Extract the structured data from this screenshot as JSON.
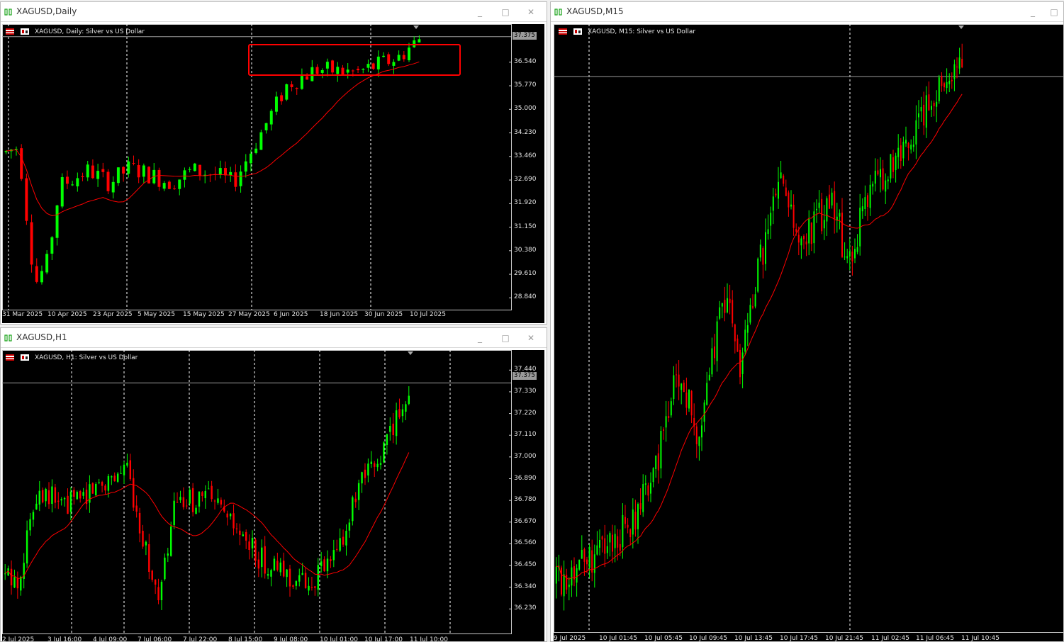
{
  "windows": [
    {
      "id": "daily",
      "title": "XAGUSD,Daily",
      "chart_label": "XAGUSD, Daily:  Silver vs US Dollar",
      "price_tag": "37.375",
      "price_levels": [
        "36.540",
        "35.770",
        "35.000",
        "34.230",
        "33.460",
        "32.690",
        "31.920",
        "31.150",
        "30.380",
        "29.610",
        "28.840"
      ],
      "time_labels": [
        "31 Mar 2025",
        "10 Apr 2025",
        "23 Apr 2025",
        "5 May 2025",
        "15 May 2025",
        "27 May 2025",
        "6 Jun 2025",
        "18 Jun 2025",
        "30 Jun 2025",
        "10 Jul 2025"
      ]
    },
    {
      "id": "h1",
      "title": "XAGUSD,H1",
      "chart_label": "XAGUSD, H1:  Silver vs US Dollar",
      "price_tag": "37.375",
      "price_levels": [
        "37.440",
        "37.330",
        "37.220",
        "37.110",
        "37.000",
        "36.890",
        "36.780",
        "36.670",
        "36.560",
        "36.450",
        "36.340",
        "36.230"
      ],
      "time_labels": [
        "2 Jul 2025",
        "3 Jul 16:00",
        "4 Jul 09:00",
        "7 Jul 06:00",
        "7 Jul 22:00",
        "8 Jul 15:00",
        "9 Jul 08:00",
        "10 Jul 01:00",
        "10 Jul 17:00",
        "11 Jul 10:00"
      ]
    },
    {
      "id": "m15",
      "title": "XAGUSD,M15",
      "chart_label": "XAGUSD, M15:  Silver vs US Dollar",
      "time_labels": [
        "9 Jul 2025",
        "10 Jul 01:45",
        "10 Jul 05:45",
        "10 Jul 09:45",
        "10 Jul 13:45",
        "10 Jul 17:45",
        "10 Jul 21:45",
        "11 Jul 02:45",
        "11 Jul 06:45",
        "11 Jul 10:45"
      ]
    }
  ],
  "buttons": {
    "minimize": "_",
    "maximize": "□",
    "close": "✕"
  },
  "colors": {
    "bull": "#00ff00",
    "bear": "#ff0000",
    "ma": "#ff0000",
    "grid": "#ffffff",
    "highlight": "#ff0000"
  },
  "icons": [
    "chart-window-icon",
    "symbol-flag-icon"
  ],
  "chart_data": [
    {
      "type": "candlestick",
      "title": "XAGUSD, Daily",
      "ylim": [
        28.5,
        37.6
      ],
      "current_price": 37.375,
      "ma_period_note": "",
      "x": [
        "31 Mar 2025",
        "10 Apr 2025",
        "23 Apr 2025",
        "5 May 2025",
        "15 May 2025",
        "27 May 2025",
        "6 Jun 2025",
        "18 Jun 2025",
        "30 Jun 2025",
        "10 Jul 2025"
      ]
    },
    {
      "type": "candlestick",
      "title": "XAGUSD, H1",
      "ylim": [
        36.12,
        37.52
      ],
      "current_price": 37.375,
      "x": [
        "2 Jul 2025",
        "3 Jul 16:00",
        "4 Jul 09:00",
        "7 Jul 06:00",
        "7 Jul 22:00",
        "8 Jul 15:00",
        "9 Jul 08:00",
        "10 Jul 01:00",
        "10 Jul 17:00",
        "11 Jul 10:00"
      ]
    },
    {
      "type": "candlestick",
      "title": "XAGUSD, M15",
      "x": [
        "9 Jul 2025",
        "10 Jul 01:45",
        "10 Jul 05:45",
        "10 Jul 09:45",
        "10 Jul 13:45",
        "10 Jul 17:45",
        "10 Jul 21:45",
        "11 Jul 02:45",
        "11 Jul 06:45",
        "11 Jul 10:45"
      ]
    }
  ]
}
